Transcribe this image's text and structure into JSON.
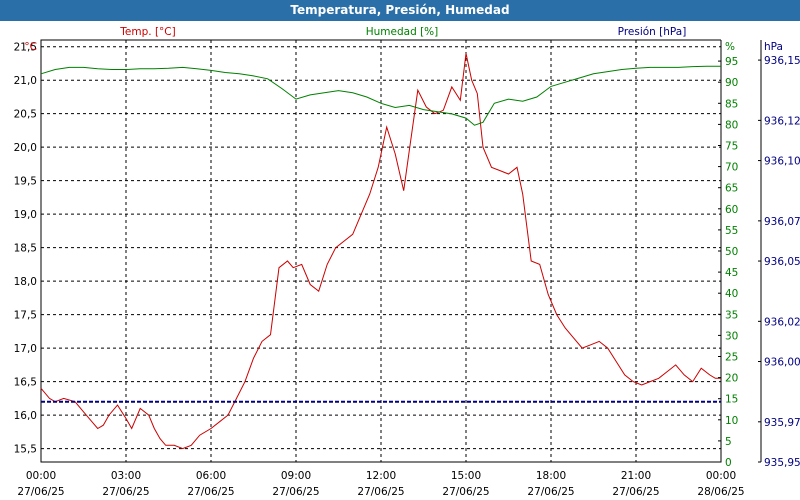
{
  "window": {
    "title": "Temperatura, Presión, Humedad"
  },
  "chart_data": {
    "type": "line",
    "title": "Temperatura, Presión, Humedad",
    "x_ticks": [
      {
        "time": "00:00",
        "date": "27/06/25"
      },
      {
        "time": "03:00",
        "date": "27/06/25"
      },
      {
        "time": "06:00",
        "date": "27/06/25"
      },
      {
        "time": "09:00",
        "date": "27/06/25"
      },
      {
        "time": "12:00",
        "date": "27/06/25"
      },
      {
        "time": "15:00",
        "date": "27/06/25"
      },
      {
        "time": "18:00",
        "date": "27/06/25"
      },
      {
        "time": "21:00",
        "date": "27/06/25"
      },
      {
        "time": "00:00",
        "date": "28/06/25"
      }
    ],
    "axes": {
      "temp": {
        "label": "Temp. [°C]",
        "unit": "°C",
        "range": [
          15.3,
          21.6
        ],
        "ticks": [
          "15,5",
          "16,0",
          "16,5",
          "17,0",
          "17,5",
          "18,0",
          "18,5",
          "19,0",
          "19,5",
          "20,0",
          "20,5",
          "21,0",
          "21,5"
        ],
        "color": "#cc0000"
      },
      "humidity": {
        "label": "Humedad [%]",
        "unit": "%",
        "range": [
          0,
          100
        ],
        "ticks": [
          "0",
          "5",
          "10",
          "15",
          "20",
          "25",
          "30",
          "35",
          "40",
          "45",
          "50",
          "55",
          "60",
          "65",
          "70",
          "75",
          "80",
          "85",
          "90",
          "95"
        ],
        "color": "#008000"
      },
      "pressure": {
        "label": "Presión [hPa]",
        "unit": "hPa",
        "range": [
          935.95,
          936.16
        ],
        "ticks": [
          "935,95",
          "935,97",
          "936,00",
          "936,02",
          "936,05",
          "936,07",
          "936,10",
          "936,12",
          "936,15"
        ],
        "color": "#000080"
      }
    },
    "grid": true,
    "series": [
      {
        "name": "Temp. [°C]",
        "axis": "temp",
        "color": "#cc0000",
        "x_hours": [
          0,
          0.3,
          0.5,
          0.8,
          1.2,
          1.5,
          1.8,
          2.0,
          2.2,
          2.4,
          2.7,
          3.0,
          3.2,
          3.5,
          3.8,
          4.0,
          4.2,
          4.4,
          4.7,
          5.0,
          5.3,
          5.6,
          6.0,
          6.3,
          6.6,
          6.9,
          7.2,
          7.5,
          7.8,
          8.1,
          8.4,
          8.7,
          8.9,
          9.2,
          9.5,
          9.8,
          10.1,
          10.4,
          10.7,
          11.0,
          11.3,
          11.6,
          11.9,
          12.2,
          12.5,
          12.8,
          13.0,
          13.3,
          13.6,
          13.9,
          14.2,
          14.5,
          14.8,
          15.0,
          15.2,
          15.4,
          15.6,
          15.9,
          16.2,
          16.5,
          16.8,
          17.0,
          17.3,
          17.6,
          17.9,
          18.2,
          18.5,
          18.8,
          19.1,
          19.4,
          19.7,
          20.0,
          20.3,
          20.6,
          20.9,
          21.2,
          21.5,
          21.8,
          22.1,
          22.4,
          22.7,
          23.0,
          23.3,
          23.6,
          23.8,
          24.0
        ],
        "values": [
          16.4,
          16.25,
          16.2,
          16.25,
          16.2,
          16.05,
          15.9,
          15.8,
          15.85,
          16.0,
          16.15,
          15.95,
          15.8,
          16.1,
          16.0,
          15.8,
          15.65,
          15.55,
          15.55,
          15.5,
          15.55,
          15.7,
          15.8,
          15.9,
          16.0,
          16.25,
          16.5,
          16.85,
          17.1,
          17.2,
          18.2,
          18.3,
          18.2,
          18.25,
          17.95,
          17.85,
          18.25,
          18.5,
          18.6,
          18.7,
          19.0,
          19.3,
          19.7,
          20.3,
          19.9,
          19.35,
          19.95,
          20.85,
          20.6,
          20.5,
          20.55,
          20.9,
          20.7,
          21.4,
          21.0,
          20.8,
          20.0,
          19.7,
          19.65,
          19.6,
          19.7,
          19.3,
          18.3,
          18.25,
          17.8,
          17.5,
          17.3,
          17.15,
          17.0,
          17.05,
          17.1,
          17.0,
          16.8,
          16.6,
          16.5,
          16.45,
          16.5,
          16.55,
          16.65,
          16.75,
          16.6,
          16.5,
          16.7,
          16.6,
          16.55,
          16.55
        ]
      },
      {
        "name": "Humedad [%]",
        "axis": "humidity",
        "color": "#008000",
        "x_hours": [
          0,
          0.5,
          1.0,
          1.5,
          2.0,
          2.5,
          3.0,
          3.5,
          4.0,
          4.5,
          5.0,
          5.5,
          6.0,
          6.5,
          7.0,
          7.5,
          8.0,
          8.5,
          9.0,
          9.5,
          10.0,
          10.5,
          11.0,
          11.5,
          12.0,
          12.5,
          13.0,
          13.5,
          14.0,
          14.5,
          15.0,
          15.3,
          15.6,
          16.0,
          16.5,
          17.0,
          17.5,
          18.0,
          18.5,
          19.0,
          19.5,
          20.0,
          20.5,
          21.0,
          21.5,
          22.0,
          22.5,
          23.0,
          23.5,
          24.0
        ],
        "values": [
          92,
          93,
          93.5,
          93.5,
          93.2,
          93.0,
          93.0,
          93.2,
          93.2,
          93.3,
          93.5,
          93.2,
          92.8,
          92.3,
          92.0,
          91.5,
          90.8,
          88.5,
          86.0,
          87.0,
          87.5,
          88.0,
          87.5,
          86.5,
          85.0,
          84.0,
          84.5,
          83.5,
          83.0,
          82.5,
          81.5,
          79.8,
          80.5,
          85.0,
          86.0,
          85.5,
          86.5,
          89.0,
          90.0,
          91.0,
          92.0,
          92.5,
          93.0,
          93.3,
          93.5,
          93.5,
          93.5,
          93.7,
          93.8,
          93.8
        ]
      },
      {
        "name": "Presión [hPa]",
        "axis": "pressure",
        "color": "#000080",
        "x_hours": [
          0,
          24
        ],
        "values": [
          935.98,
          935.98
        ]
      }
    ]
  }
}
